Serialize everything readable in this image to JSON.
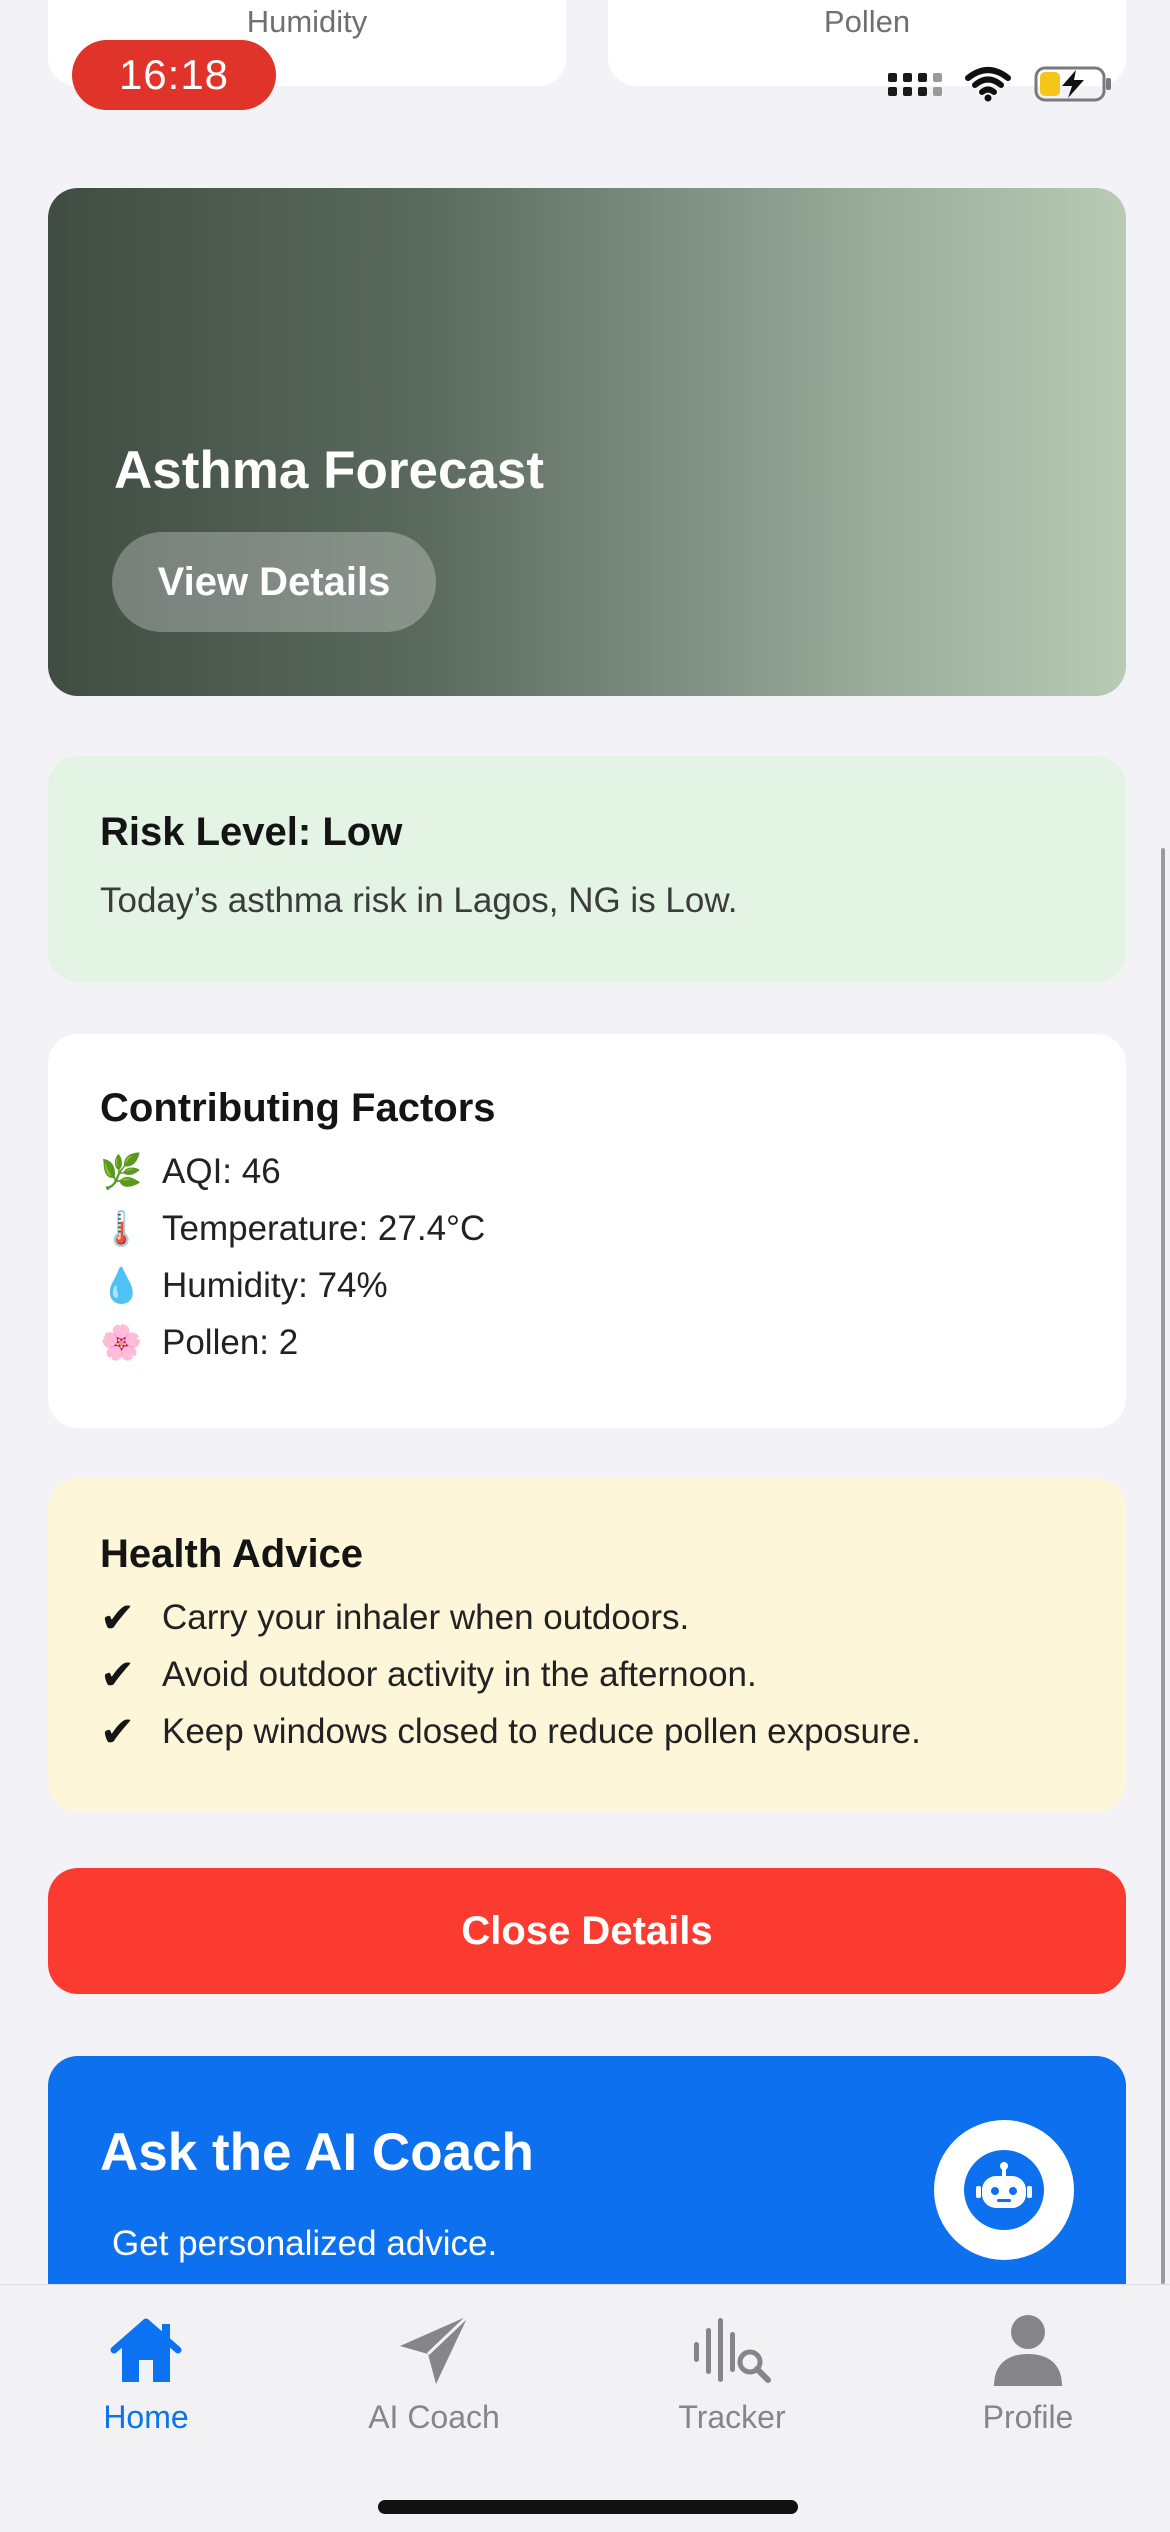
{
  "top_cards": {
    "left_label": "Humidity",
    "right_label": "Pollen"
  },
  "status_bar": {
    "time": "16:18",
    "time_pill_color": "#e0332a",
    "icons": [
      "cellular-signal-icon",
      "wifi-icon",
      "battery-charging-icon"
    ]
  },
  "forecast": {
    "title": "Asthma Forecast",
    "button_label": "View Details"
  },
  "risk": {
    "heading": "Risk Level: Low",
    "description": "Today’s asthma risk in Lagos, NG is Low.",
    "bg_color": "#e3f3e4"
  },
  "factors": {
    "heading": "Contributing Factors",
    "items": [
      {
        "icon": "🌿",
        "icon_name": "leaf-icon",
        "text": "AQI: 46"
      },
      {
        "icon": "🌡️",
        "icon_name": "thermometer-icon",
        "text": "Temperature: 27.4°C"
      },
      {
        "icon": "💧",
        "icon_name": "droplet-icon",
        "text": "Humidity: 74%"
      },
      {
        "icon": "🌸",
        "icon_name": "blossom-icon",
        "text": "Pollen: 2"
      }
    ]
  },
  "advice": {
    "heading": "Health Advice",
    "check": "✔",
    "items": [
      "Carry your inhaler when outdoors.",
      "Avoid outdoor activity in the afternoon.",
      "Keep windows closed to reduce pollen exposure."
    ],
    "bg_color": "#fdf6d9"
  },
  "close_button": {
    "label": "Close Details",
    "color": "#fb3b30"
  },
  "coach": {
    "title": "Ask the AI Coach",
    "subtitle": "Get personalized advice.",
    "color": "#0c70ef"
  },
  "tabbar": {
    "active_color": "#0b72f2",
    "tabs": [
      {
        "label": "Home",
        "icon": "house-icon"
      },
      {
        "label": "AI Coach",
        "icon": "paper-plane-icon"
      },
      {
        "label": "Tracker",
        "icon": "waveform-search-icon"
      },
      {
        "label": "Profile",
        "icon": "person-icon"
      }
    ]
  }
}
